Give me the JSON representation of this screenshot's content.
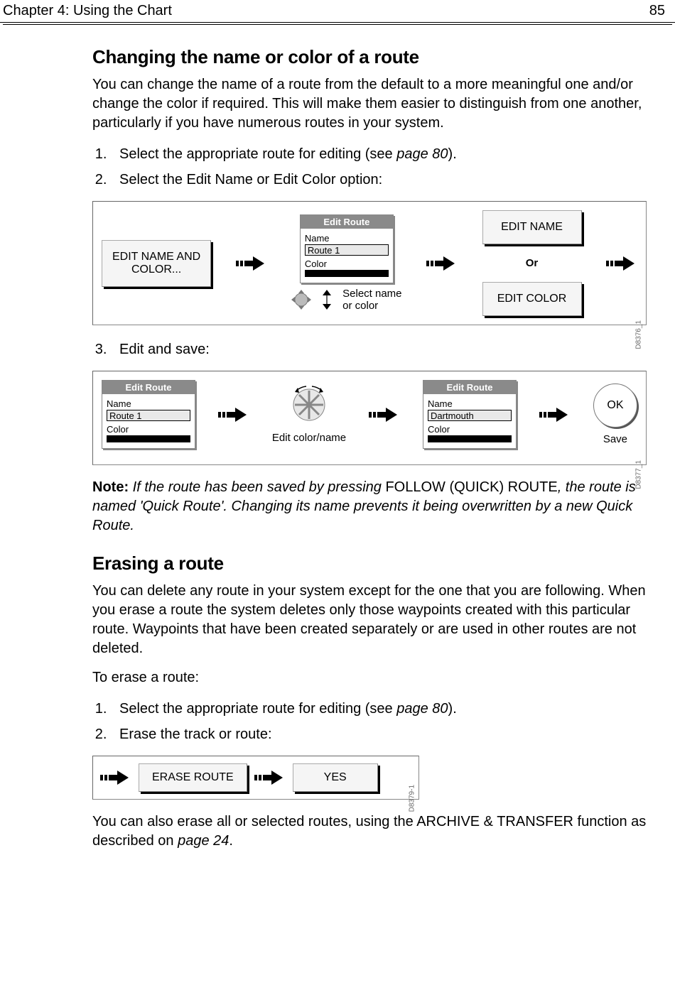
{
  "header": {
    "chapter": "Chapter 4: Using the Chart",
    "page": "85"
  },
  "section1": {
    "heading": "Changing the name or color of a route",
    "intro": "You can change the name of a route from the default to a more meaningful one and/or change the color if required. This will make them easier to distinguish from one another, particularly if you have numerous routes in your system.",
    "step1_a": "Select the appropriate route for editing (see ",
    "step1_ref": "page 80",
    "step1_b": ").",
    "step2": "Select the Edit Name or Edit Color option:",
    "step3": "Edit and save:"
  },
  "fig1": {
    "btn_editnamecolor_l1": "EDIT NAME AND",
    "btn_editnamecolor_l2": "COLOR...",
    "panel_title": "Edit Route",
    "panel_name_lbl": "Name",
    "panel_name_val": "Route 1",
    "panel_color_lbl": "Color",
    "cursor_caption_l1": "Select name",
    "cursor_caption_l2": "or color",
    "btn_editname": "EDIT NAME",
    "or": "Or",
    "btn_editcolor": "EDIT COLOR",
    "id": "D8376_1"
  },
  "fig2": {
    "panelA_title": "Edit Route",
    "panelA_name_lbl": "Name",
    "panelA_name_val": "Route 1",
    "panelA_color_lbl": "Color",
    "rotary_caption": "Edit color/name",
    "panelB_title": "Edit Route",
    "panelB_name_lbl": "Name",
    "panelB_name_val": "Dartmouth",
    "panelB_color_lbl": "Color",
    "ok_label": "OK",
    "ok_caption": "Save",
    "id": "D8377_1"
  },
  "note": {
    "lead": "Note: ",
    "i1": "If the route has been saved by pressing ",
    "plain": "FOLLOW (QUICK) ROUTE",
    "i2": ", the route is named 'Quick Route'. Changing its name prevents it being overwritten by a new Quick Route."
  },
  "section2": {
    "heading": "Erasing a route",
    "intro": "You can delete any route in your system except for the one that you are following. When you erase a route the system deletes only those waypoints created with this particular route. Waypoints that have been created separately or are used in other routes are not deleted.",
    "lead": "To erase a route:",
    "step1_a": "Select the appropriate route for editing (see ",
    "step1_ref": "page 80",
    "step1_b": ").",
    "step2": "Erase the track or route:"
  },
  "fig3": {
    "btn_erase": "ERASE ROUTE",
    "btn_yes": "YES",
    "id": "D8379-1"
  },
  "trailer_a": "You can also erase all or selected routes, using the ARCHIVE & TRANSFER function as described on ",
  "trailer_ref": "page 24",
  "trailer_b": "."
}
